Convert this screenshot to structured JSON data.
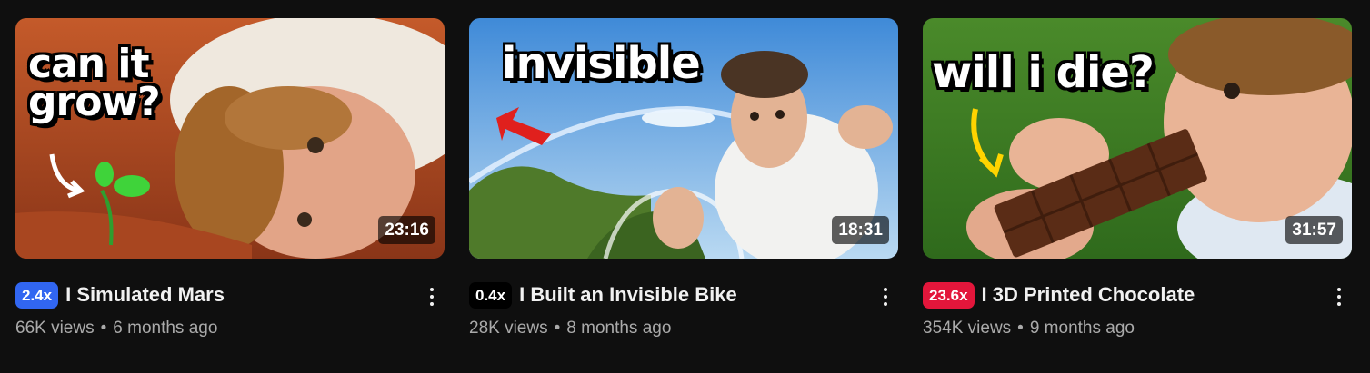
{
  "videos": [
    {
      "thumbnail_text": "can it\ngrow?",
      "duration": "23:16",
      "badge": "2.4x",
      "badge_color": "#3166f1",
      "title": "I Simulated Mars",
      "views": "66K views",
      "separator": "•",
      "age": "6 months ago"
    },
    {
      "thumbnail_text": "invisible",
      "duration": "18:31",
      "badge": "0.4x",
      "badge_color": "#000000",
      "title": "I Built an Invisible Bike",
      "views": "28K views",
      "separator": "•",
      "age": "8 months ago"
    },
    {
      "thumbnail_text": "will i die?",
      "duration": "31:57",
      "badge": "23.6x",
      "badge_color": "#e3163b",
      "title": "I 3D Printed Chocolate",
      "views": "354K views",
      "separator": "•",
      "age": "9 months ago"
    }
  ],
  "icons": {
    "more_menu": "more-vert-icon"
  },
  "colors": {
    "background": "#0f0f0f",
    "title": "#f1f1f1",
    "meta": "#aaaaaa"
  }
}
